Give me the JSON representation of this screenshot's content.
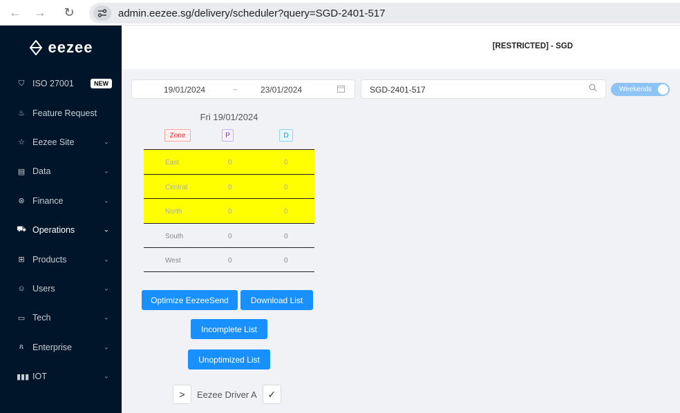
{
  "browser": {
    "url": "admin.eezee.sg/delivery/scheduler?query=SGD-2401-517",
    "back_icon": "arrow-left-icon",
    "forward_icon": "arrow-right-icon",
    "reload_icon": "reload-icon"
  },
  "sidebar": {
    "logo_text": "eezee",
    "items": [
      {
        "label": "ISO 27001",
        "icon": "shield-check-icon",
        "badge": "NEW"
      },
      {
        "label": "Feature Request",
        "icon": "cup-icon"
      },
      {
        "label": "Eezee Site",
        "icon": "star-icon"
      },
      {
        "label": "Data",
        "icon": "database-icon"
      },
      {
        "label": "Finance",
        "icon": "dollar-circle-icon"
      },
      {
        "label": "Operations",
        "icon": "cart-icon"
      },
      {
        "label": "Products",
        "icon": "gift-icon"
      },
      {
        "label": "Users",
        "icon": "smile-icon"
      },
      {
        "label": "Tech",
        "icon": "laptop-icon"
      },
      {
        "label": "Enterprise",
        "icon": "team-icon"
      },
      {
        "label": "IOT",
        "icon": "barcode-icon"
      }
    ]
  },
  "header": {
    "title": "[RESTRICTED] - SGD"
  },
  "filters": {
    "date_start": "19/01/2024",
    "date_separator": "~",
    "date_end": "23/01/2024",
    "search_value": "SGD-2401-517",
    "weekends_label": "Weekends",
    "weekends_on": true
  },
  "schedule": {
    "day_title": "Fri 19/01/2024",
    "col_zone": "Zone",
    "col_p": "P",
    "col_d": "D",
    "rows": [
      {
        "zone": "East",
        "p": "0",
        "d": "0",
        "highlight": true
      },
      {
        "zone": "Central",
        "p": "0",
        "d": "0",
        "highlight": true
      },
      {
        "zone": "North",
        "p": "0",
        "d": "0",
        "highlight": true
      },
      {
        "zone": "South",
        "p": "0",
        "d": "0",
        "highlight": false
      },
      {
        "zone": "West",
        "p": "0",
        "d": "0",
        "highlight": false
      }
    ]
  },
  "actions": {
    "optimize": "Optimize EezeeSend",
    "download": "Download List",
    "incomplete": "Incomplete List",
    "unoptimized": "Unoptimized List"
  },
  "driver": {
    "expand_glyph": ">",
    "name": "Eezee Driver A",
    "confirm_glyph": "✓"
  },
  "colors": {
    "sidebar_bg": "#001529",
    "primary": "#1890ff",
    "highlight": "#ffff00"
  }
}
